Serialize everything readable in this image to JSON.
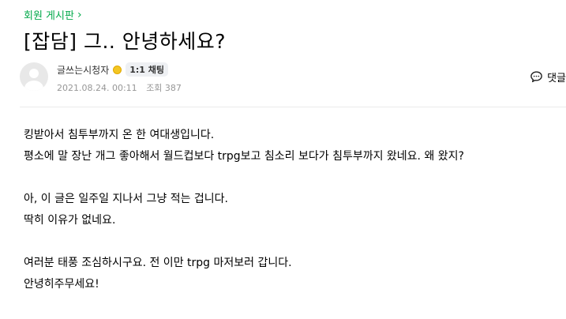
{
  "board": {
    "name": "회원 게시판",
    "chevron": "›"
  },
  "post": {
    "title": "[잡담] 그.. 안녕하세요?",
    "author": "글쓰는시청자",
    "chat_label": "1:1 채팅",
    "date": "2021.08.24. 00:11",
    "views_label": "조회 387",
    "comment_label": "댓글",
    "paragraphs": [
      [
        "킹받아서 침투부까지 온 한 여대생입니다.",
        "평소에 말 장난 개그 좋아해서 월드컵보다 trpg보고 침소리 보다가 침투부까지 왔네요. 왜 왔지?"
      ],
      [
        "아, 이 글은 일주일 지나서 그냥 적는 겁니다.",
        "딱히 이유가 없네요."
      ],
      [
        "여러분 태풍 조심하시구요. 전 이만 trpg 마저보러 갑니다.",
        "안녕히주무세요!"
      ]
    ]
  },
  "colors": {
    "board_link": "#03a94a",
    "meta": "#979797",
    "medal": "#f3c623"
  },
  "icons": {
    "avatar": "default-avatar",
    "medal": "medal-icon",
    "comment": "speech-bubble-icon"
  }
}
